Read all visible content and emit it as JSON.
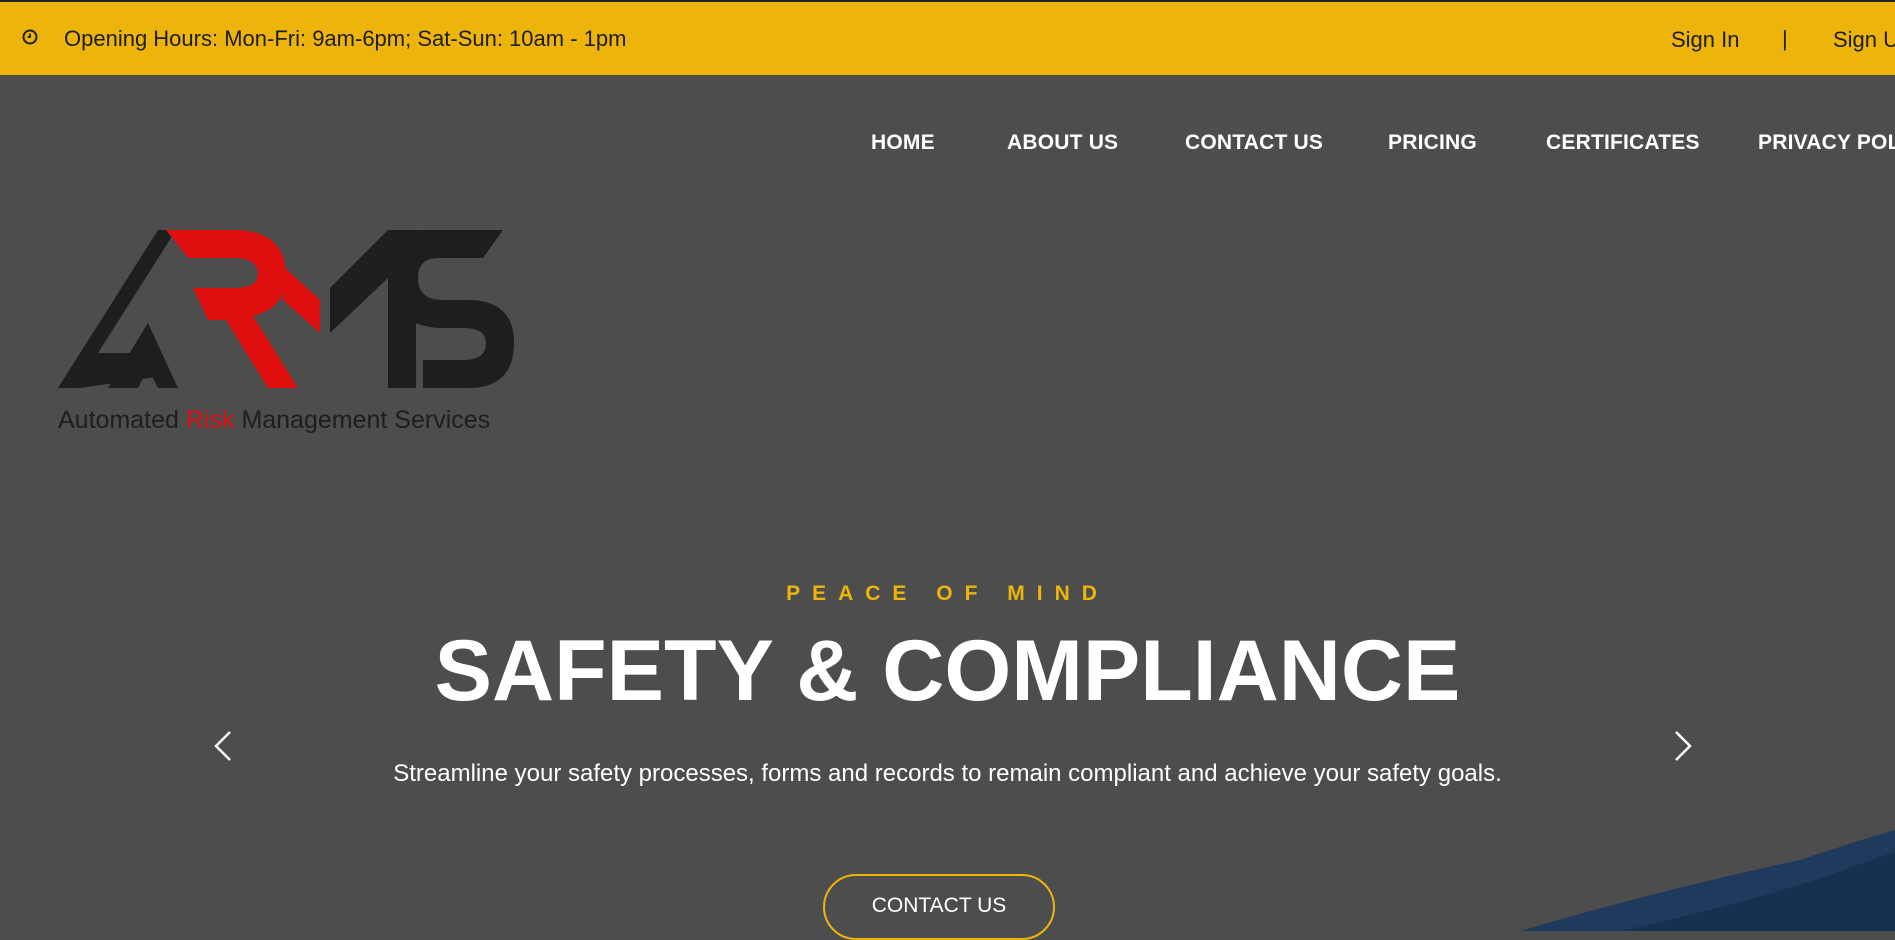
{
  "topbar": {
    "hours_icon": "clock-icon",
    "hours_text": "Opening Hours: Mon-Fri: 9am-6pm; Sat-Sun: 10am - 1pm",
    "sign_in": "Sign In",
    "separator": "|",
    "sign_up": "Sign Up"
  },
  "nav": {
    "items": [
      {
        "label": "HOME"
      },
      {
        "label": "ABOUT US"
      },
      {
        "label": "CONTACT US"
      },
      {
        "label": "PRICING"
      },
      {
        "label": "CERTIFICATES"
      },
      {
        "label": "PRIVACY POLICY"
      }
    ]
  },
  "logo": {
    "tagline_part1": "Automated",
    "tagline_risk": "Risk",
    "tagline_part2": "Management Services"
  },
  "hero": {
    "subtitle": "PEACE OF MIND",
    "title": "SAFETY & COMPLIANCE",
    "description": "Streamline your safety processes, forms and records to remain compliant and achieve your safety goals.",
    "cta_label": "CONTACT US",
    "prev_icon": "chevron-left-icon",
    "next_icon": "chevron-right-icon"
  },
  "colors": {
    "accent": "#edb50c",
    "background": "#4d4d4d",
    "logo_red": "#e01010",
    "logo_dark": "#1e1e1e"
  }
}
